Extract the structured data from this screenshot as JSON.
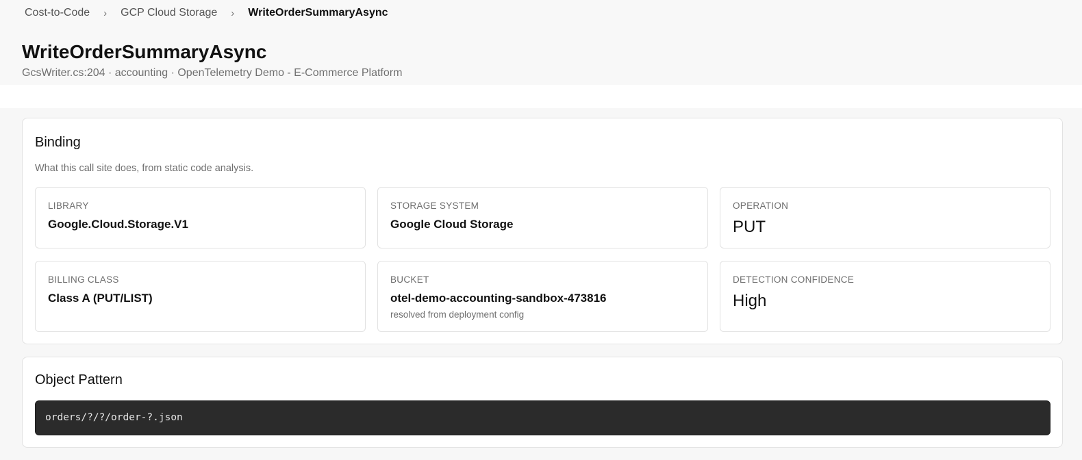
{
  "breadcrumb": {
    "items": [
      "Cost-to-Code",
      "GCP Cloud Storage",
      "WriteOrderSummaryAsync"
    ],
    "separator": "›"
  },
  "page": {
    "title": "WriteOrderSummaryAsync",
    "subtitle": "GcsWriter.cs:204 · accounting · OpenTelemetry Demo - E-Commerce Platform"
  },
  "binding": {
    "title": "Binding",
    "description": "What this call site does, from static code analysis.",
    "tiles": [
      {
        "label": "Library",
        "value": "Google.Cloud.Storage.V1"
      },
      {
        "label": "Storage System",
        "value": "Google Cloud Storage"
      },
      {
        "label": "Operation",
        "value": "PUT"
      },
      {
        "label": "Billing Class",
        "value": "Class A (PUT/LIST)"
      },
      {
        "label": "Bucket",
        "value": "otel-demo-accounting-sandbox-473816",
        "note": "resolved from deployment config"
      },
      {
        "label": "Detection Confidence",
        "value": "High"
      }
    ]
  },
  "object_pattern": {
    "title": "Object Pattern",
    "code": "orders/?/?/order-?.json"
  },
  "colors": {
    "page_bg": "#f7f7f7",
    "card_bg": "#ffffff",
    "border": "#e2e2e2",
    "code_bg": "#2b2b2b",
    "code_text": "#e6e6e6",
    "muted_text": "#6e6e6e"
  }
}
